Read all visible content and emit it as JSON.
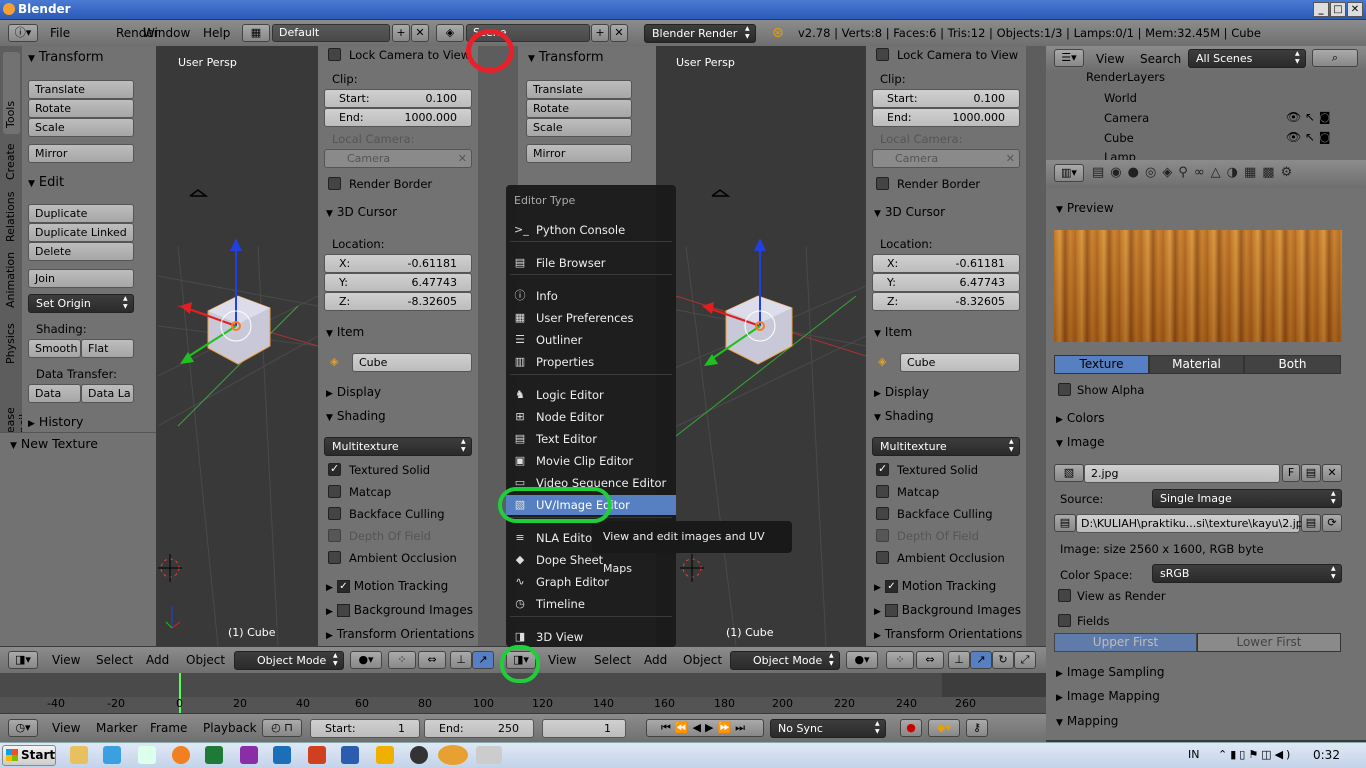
{
  "window": {
    "title": "Blender"
  },
  "topbar": {
    "menus": [
      "File",
      "Render",
      "Window",
      "Help"
    ],
    "layout": "Default",
    "scene": "Scene",
    "engine": "Blender Render",
    "stats": "v2.78 | Verts:8 | Faces:6 | Tris:12 | Objects:1/3 | Lamps:0/1 | Mem:32.45M | Cube"
  },
  "tool_shelf": {
    "tabs": [
      "Tools",
      "Create",
      "Relations",
      "Animation",
      "Physics",
      "Grease Pencil"
    ],
    "transform_title": "Transform",
    "translate": "Translate",
    "rotate": "Rotate",
    "scale": "Scale",
    "mirror": "Mirror",
    "edit_title": "Edit",
    "duplicate": "Duplicate",
    "duplicate_linked": "Duplicate Linked",
    "delete": "Delete",
    "join": "Join",
    "set_origin": "Set Origin",
    "shading_label": "Shading:",
    "smooth": "Smooth",
    "flat": "Flat",
    "data_transfer_label": "Data Transfer:",
    "data": "Data",
    "data_la": "Data La",
    "history": "History",
    "new_texture": "New Texture"
  },
  "viewport": {
    "persp": "User Persp",
    "object_label": "(1) Cube"
  },
  "properties_panel": {
    "lock_camera": "Lock Camera to View",
    "clip_label": "Clip:",
    "start_label": "Start:",
    "start_value": "0.100",
    "end_label": "End:",
    "end_value": "1000.000",
    "local_camera": "Local Camera:",
    "camera": "Camera",
    "render_border": "Render Border",
    "cursor_title": "3D Cursor",
    "location_label": "Location:",
    "x_label": "X:",
    "x_value": "-0.61181",
    "y_label": "Y:",
    "y_value": "6.47743",
    "z_label": "Z:",
    "z_value": "-8.32605",
    "item_title": "Item",
    "item_name": "Cube",
    "display_title": "Display",
    "shading_title": "Shading",
    "multitexture": "Multitexture",
    "textured_solid": "Textured Solid",
    "matcap": "Matcap",
    "backface": "Backface Culling",
    "dof": "Depth Of Field",
    "ao": "Ambient Occlusion",
    "motion_tracking": "Motion Tracking",
    "background_images": "Background Images",
    "transform_orientations": "Transform Orientations"
  },
  "viewport_header": {
    "view": "View",
    "select": "Select",
    "add": "Add",
    "object": "Object",
    "mode": "Object Mode"
  },
  "editor_menu": {
    "title": "Editor Type",
    "items": [
      {
        "label": "Python Console",
        "icon": "python-console-icon",
        "glyph": ">_"
      },
      {
        "label": "File Browser",
        "icon": "folder-icon",
        "glyph": "▤"
      },
      {
        "label": "Info",
        "icon": "info-icon",
        "glyph": "ⓘ"
      },
      {
        "label": "User Preferences",
        "icon": "preferences-icon",
        "glyph": "▦"
      },
      {
        "label": "Outliner",
        "icon": "outliner-icon",
        "glyph": "☰"
      },
      {
        "label": "Properties",
        "icon": "properties-icon",
        "glyph": "▥"
      },
      {
        "label": "Logic Editor",
        "icon": "logic-icon",
        "glyph": "♞"
      },
      {
        "label": "Node Editor",
        "icon": "node-icon",
        "glyph": "⊞"
      },
      {
        "label": "Text Editor",
        "icon": "text-icon",
        "glyph": "▤"
      },
      {
        "label": "Movie Clip Editor",
        "icon": "movie-clip-icon",
        "glyph": "▣"
      },
      {
        "label": "Video Sequence Editor",
        "icon": "sequence-icon",
        "glyph": "▭"
      },
      {
        "label": "UV/Image Editor",
        "icon": "image-icon",
        "glyph": "▧"
      },
      {
        "label": "NLA Editor",
        "icon": "nla-icon",
        "glyph": "≡"
      },
      {
        "label": "Dope Sheet",
        "icon": "dopesheet-icon",
        "glyph": "◆"
      },
      {
        "label": "Graph Editor",
        "icon": "graph-icon",
        "glyph": "∿"
      },
      {
        "label": "Timeline",
        "icon": "timeline-icon",
        "glyph": "◷"
      },
      {
        "label": "3D View",
        "icon": "cube-icon",
        "glyph": "◨"
      }
    ]
  },
  "tooltip": "View and edit images and UV Maps",
  "outliner": {
    "view": "View",
    "search": "Search",
    "filter": "All Scenes",
    "rows": [
      "RenderLayers",
      "World",
      "Camera",
      "Cube",
      "Lamp"
    ]
  },
  "texture_props": {
    "preview": "Preview",
    "tab_texture": "Texture",
    "tab_material": "Material",
    "tab_both": "Both",
    "show_alpha": "Show Alpha",
    "colors": "Colors",
    "image": "Image",
    "image_name": "2.jpg",
    "f_label": "F",
    "source_label": "Source:",
    "source_value": "Single Image",
    "path": "D:\\KULIAH\\praktiku...si\\texture\\kayu\\2.jpg",
    "image_info": "Image: size 2560 x 1600, RGB byte",
    "color_space_label": "Color Space:",
    "color_space": "sRGB",
    "view_as_render": "View as Render",
    "fields": "Fields",
    "upper_first": "Upper First",
    "lower_first": "Lower First",
    "image_sampling": "Image Sampling",
    "image_mapping": "Image Mapping",
    "mapping": "Mapping"
  },
  "timeline": {
    "ticks": [
      "-40",
      "-20",
      "0",
      "20",
      "40",
      "60",
      "80",
      "100",
      "120",
      "140",
      "160",
      "180",
      "200",
      "220",
      "240",
      "260"
    ],
    "view": "View",
    "marker": "Marker",
    "frame": "Frame",
    "playback": "Playback",
    "start_label": "Start:",
    "start": "1",
    "end_label": "End:",
    "end": "250",
    "current": "1",
    "sync": "No Sync"
  },
  "taskbar": {
    "start": "Start",
    "lang": "IN",
    "time": "0:32"
  },
  "colors": {
    "accent": "#5680c2",
    "annotation_red": "#e8202a",
    "annotation_green": "#1fcf3a"
  }
}
